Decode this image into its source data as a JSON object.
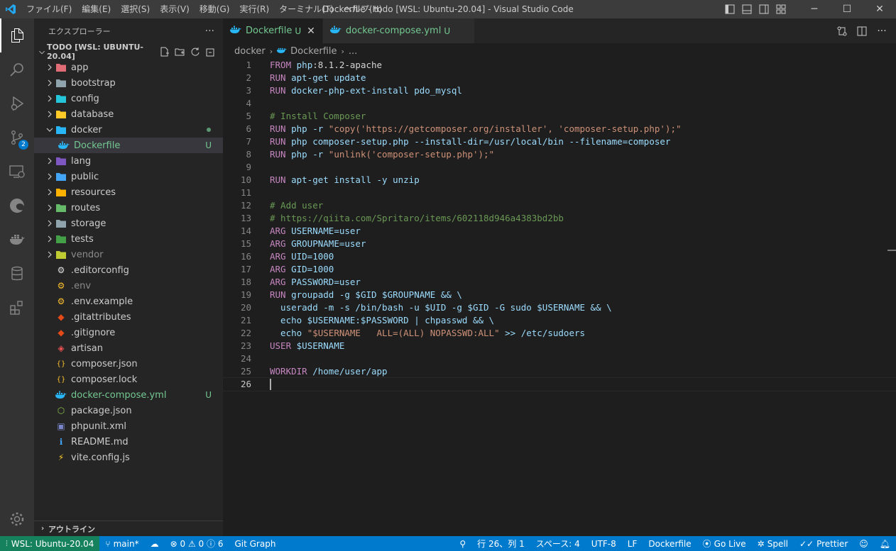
{
  "window": {
    "title": "Dockerfile - todo [WSL: Ubuntu-20.04] - Visual Studio Code",
    "menu": [
      "ファイル(F)",
      "編集(E)",
      "選択(S)",
      "表示(V)",
      "移動(G)",
      "実行(R)",
      "ターミナル(T)",
      "ヘルプ(H)"
    ]
  },
  "activity": {
    "scm_badge": "2"
  },
  "sidebar": {
    "header": "エクスプローラー",
    "section": "TODO [WSL: UBUNTU-20.04]",
    "items": [
      {
        "label": "app",
        "type": "folder",
        "color": "#e06c75",
        "expanded": false
      },
      {
        "label": "bootstrap",
        "type": "folder",
        "color": "#90a4ae",
        "expanded": false
      },
      {
        "label": "config",
        "type": "folder",
        "color": "#26c6da",
        "expanded": false
      },
      {
        "label": "database",
        "type": "folder",
        "color": "#ffca28",
        "expanded": false
      },
      {
        "label": "docker",
        "type": "folder",
        "color": "#29b6f6",
        "expanded": true,
        "modified": true
      },
      {
        "label": "Dockerfile",
        "type": "docker",
        "color": "#29b6f6",
        "child": true,
        "selected": true,
        "deco": "U"
      },
      {
        "label": "lang",
        "type": "folder",
        "color": "#7e57c2",
        "expanded": false
      },
      {
        "label": "public",
        "type": "folder",
        "color": "#42a5f5",
        "expanded": false
      },
      {
        "label": "resources",
        "type": "folder",
        "color": "#ffb300",
        "expanded": false
      },
      {
        "label": "routes",
        "type": "folder",
        "color": "#66bb6a",
        "expanded": false
      },
      {
        "label": "storage",
        "type": "folder",
        "color": "#90a4ae",
        "expanded": false
      },
      {
        "label": "tests",
        "type": "folder",
        "color": "#43a047",
        "expanded": false
      },
      {
        "label": "vendor",
        "type": "folder",
        "color": "#c0ca33",
        "expanded": false,
        "dim": true
      },
      {
        "label": ".editorconfig",
        "type": "file",
        "icon": "⚙",
        "color": "#e0e0e0"
      },
      {
        "label": ".env",
        "type": "file",
        "icon": "⚙",
        "color": "#fbc02d",
        "dim": true
      },
      {
        "label": ".env.example",
        "type": "file",
        "icon": "⚙",
        "color": "#fbc02d"
      },
      {
        "label": ".gitattributes",
        "type": "file",
        "icon": "◆",
        "color": "#e64a19"
      },
      {
        "label": ".gitignore",
        "type": "file",
        "icon": "◆",
        "color": "#e64a19"
      },
      {
        "label": "artisan",
        "type": "file",
        "icon": "◈",
        "color": "#ef5350"
      },
      {
        "label": "composer.json",
        "type": "file",
        "icon": "{}",
        "color": "#fbc02d"
      },
      {
        "label": "composer.lock",
        "type": "file",
        "icon": "{}",
        "color": "#fbc02d"
      },
      {
        "label": "docker-compose.yml",
        "type": "docker",
        "color": "#29b6f6",
        "deco": "U",
        "untracked": true
      },
      {
        "label": "package.json",
        "type": "file",
        "icon": "⬡",
        "color": "#8bc34a"
      },
      {
        "label": "phpunit.xml",
        "type": "file",
        "icon": "▣",
        "color": "#7986cb"
      },
      {
        "label": "README.md",
        "type": "file",
        "icon": "ℹ",
        "color": "#42a5f5"
      },
      {
        "label": "vite.config.js",
        "type": "file",
        "icon": "⚡",
        "color": "#ffca28"
      }
    ],
    "outline": "アウトライン"
  },
  "editor": {
    "tabs": [
      {
        "label": "Dockerfile",
        "status": "U",
        "active": true
      },
      {
        "label": "docker-compose.yml",
        "status": "U",
        "active": false
      }
    ],
    "breadcrumb": [
      "docker",
      "Dockerfile",
      "..."
    ],
    "lines": [
      [
        [
          "kw",
          "FROM "
        ],
        [
          "tx",
          "php"
        ],
        [
          "op",
          ":8.1.2-apache"
        ]
      ],
      [
        [
          "kw",
          "RUN "
        ],
        [
          "tx",
          "apt-get update"
        ]
      ],
      [
        [
          "kw",
          "RUN "
        ],
        [
          "tx",
          "docker-php-ext-install pdo_mysql"
        ]
      ],
      [],
      [
        [
          "cm",
          "# Install Composer"
        ]
      ],
      [
        [
          "kw",
          "RUN "
        ],
        [
          "tx",
          "php -r "
        ],
        [
          "str",
          "\"copy('https://getcomposer.org/installer', 'composer-setup.php');\""
        ]
      ],
      [
        [
          "kw",
          "RUN "
        ],
        [
          "tx",
          "php composer-setup.php --install-dir=/usr/local/bin --filename=composer"
        ]
      ],
      [
        [
          "kw",
          "RUN "
        ],
        [
          "tx",
          "php -r "
        ],
        [
          "str",
          "\"unlink('composer-setup.php');\""
        ]
      ],
      [],
      [
        [
          "kw",
          "RUN "
        ],
        [
          "tx",
          "apt-get install -y unzip"
        ]
      ],
      [],
      [
        [
          "cm",
          "# Add user"
        ]
      ],
      [
        [
          "cm",
          "# https://qiita.com/Spritaro/items/602118d946a4383bd2bb"
        ]
      ],
      [
        [
          "kw",
          "ARG "
        ],
        [
          "tx",
          "USERNAME=user"
        ]
      ],
      [
        [
          "kw",
          "ARG "
        ],
        [
          "tx",
          "GROUPNAME=user"
        ]
      ],
      [
        [
          "kw",
          "ARG "
        ],
        [
          "tx",
          "UID=1000"
        ]
      ],
      [
        [
          "kw",
          "ARG "
        ],
        [
          "tx",
          "GID=1000"
        ]
      ],
      [
        [
          "kw",
          "ARG "
        ],
        [
          "tx",
          "PASSWORD=user"
        ]
      ],
      [
        [
          "kw",
          "RUN "
        ],
        [
          "tx",
          "groupadd -g $GID $GROUPNAME && \\"
        ]
      ],
      [
        [
          "tx",
          "  useradd -m -s /bin/bash -u $UID -g $GID -G sudo $USERNAME && \\"
        ]
      ],
      [
        [
          "tx",
          "  echo $USERNAME:$PASSWORD | chpasswd && \\"
        ]
      ],
      [
        [
          "tx",
          "  echo "
        ],
        [
          "str",
          "\"$USERNAME   ALL=(ALL) NOPASSWD:ALL\""
        ],
        [
          "tx",
          " >> /etc/sudoers"
        ]
      ],
      [
        [
          "kw",
          "USER "
        ],
        [
          "tx",
          "$USERNAME"
        ]
      ],
      [],
      [
        [
          "kw",
          "WORKDIR "
        ],
        [
          "tx",
          "/home/user/app"
        ]
      ],
      []
    ],
    "current_line": 26
  },
  "status": {
    "remote": "WSL: Ubuntu-20.04",
    "branch": "main*",
    "errors": "0",
    "warnings": "0",
    "info": "6",
    "git_graph": "Git Graph",
    "position": "行 26、列 1",
    "spaces": "スペース: 4",
    "encoding": "UTF-8",
    "eol": "LF",
    "language": "Dockerfile",
    "golive": "Go Live",
    "spell": "Spell",
    "prettier": "Prettier"
  },
  "colors": {
    "accent": "#007acc",
    "remote": "#16825d",
    "untracked": "#73c991"
  }
}
